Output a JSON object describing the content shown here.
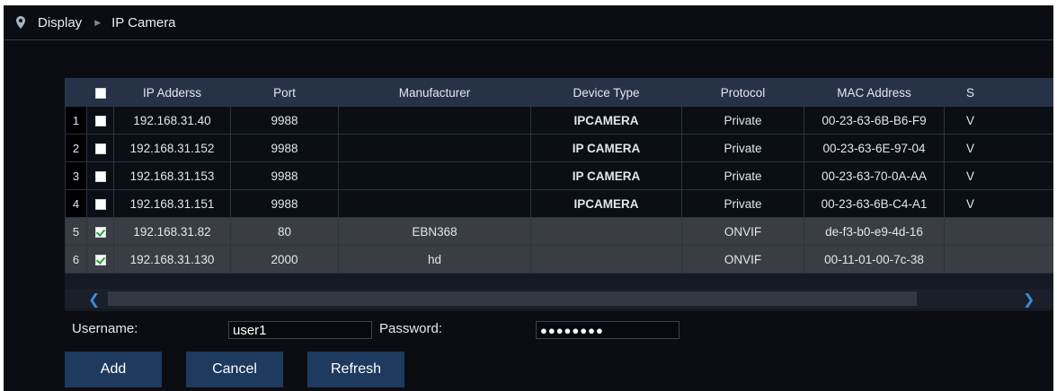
{
  "breadcrumb": {
    "root": "Display",
    "current": "IP Camera"
  },
  "table": {
    "headers": [
      "IP Adderss",
      "Port",
      "Manufacturer",
      "Device Type",
      "Protocol",
      "MAC Address",
      "S"
    ],
    "rows": [
      {
        "num": "1",
        "checked": false,
        "ip": "192.168.31.40",
        "port": "9988",
        "manufacturer": "",
        "device_type": "IPCAMERA",
        "protocol": "Private",
        "mac": "00-23-63-6B-B6-F9",
        "extra": "V"
      },
      {
        "num": "2",
        "checked": false,
        "ip": "192.168.31.152",
        "port": "9988",
        "manufacturer": "",
        "device_type": "IP CAMERA",
        "protocol": "Private",
        "mac": "00-23-63-6E-97-04",
        "extra": "V"
      },
      {
        "num": "3",
        "checked": false,
        "ip": "192.168.31.153",
        "port": "9988",
        "manufacturer": "",
        "device_type": "IP CAMERA",
        "protocol": "Private",
        "mac": "00-23-63-70-0A-AA",
        "extra": "V"
      },
      {
        "num": "4",
        "checked": false,
        "ip": "192.168.31.151",
        "port": "9988",
        "manufacturer": "",
        "device_type": "IPCAMERA",
        "protocol": "Private",
        "mac": "00-23-63-6B-C4-A1",
        "extra": "V"
      },
      {
        "num": "5",
        "checked": true,
        "ip": "192.168.31.82",
        "port": "80",
        "manufacturer": "EBN368",
        "device_type": "",
        "protocol": "ONVIF",
        "mac": "de-f3-b0-e9-4d-16",
        "extra": ""
      },
      {
        "num": "6",
        "checked": true,
        "ip": "192.168.31.130",
        "port": "2000",
        "manufacturer": "hd",
        "device_type": "",
        "protocol": "ONVIF",
        "mac": "00-11-01-00-7c-38",
        "extra": ""
      }
    ]
  },
  "form": {
    "username_label": "Username:",
    "username_value": "user1",
    "password_label": "Password:",
    "password_value": "●●●●●●●●"
  },
  "buttons": {
    "add": "Add",
    "cancel": "Cancel",
    "refresh": "Refresh"
  },
  "colors": {
    "background": "#0b0d12",
    "header_row": "#253247",
    "onvif_row": "#3a3d44",
    "button": "#1e3a5e",
    "scroll_arrow": "#3d8bdc",
    "check_green": "#2f9c2f"
  }
}
